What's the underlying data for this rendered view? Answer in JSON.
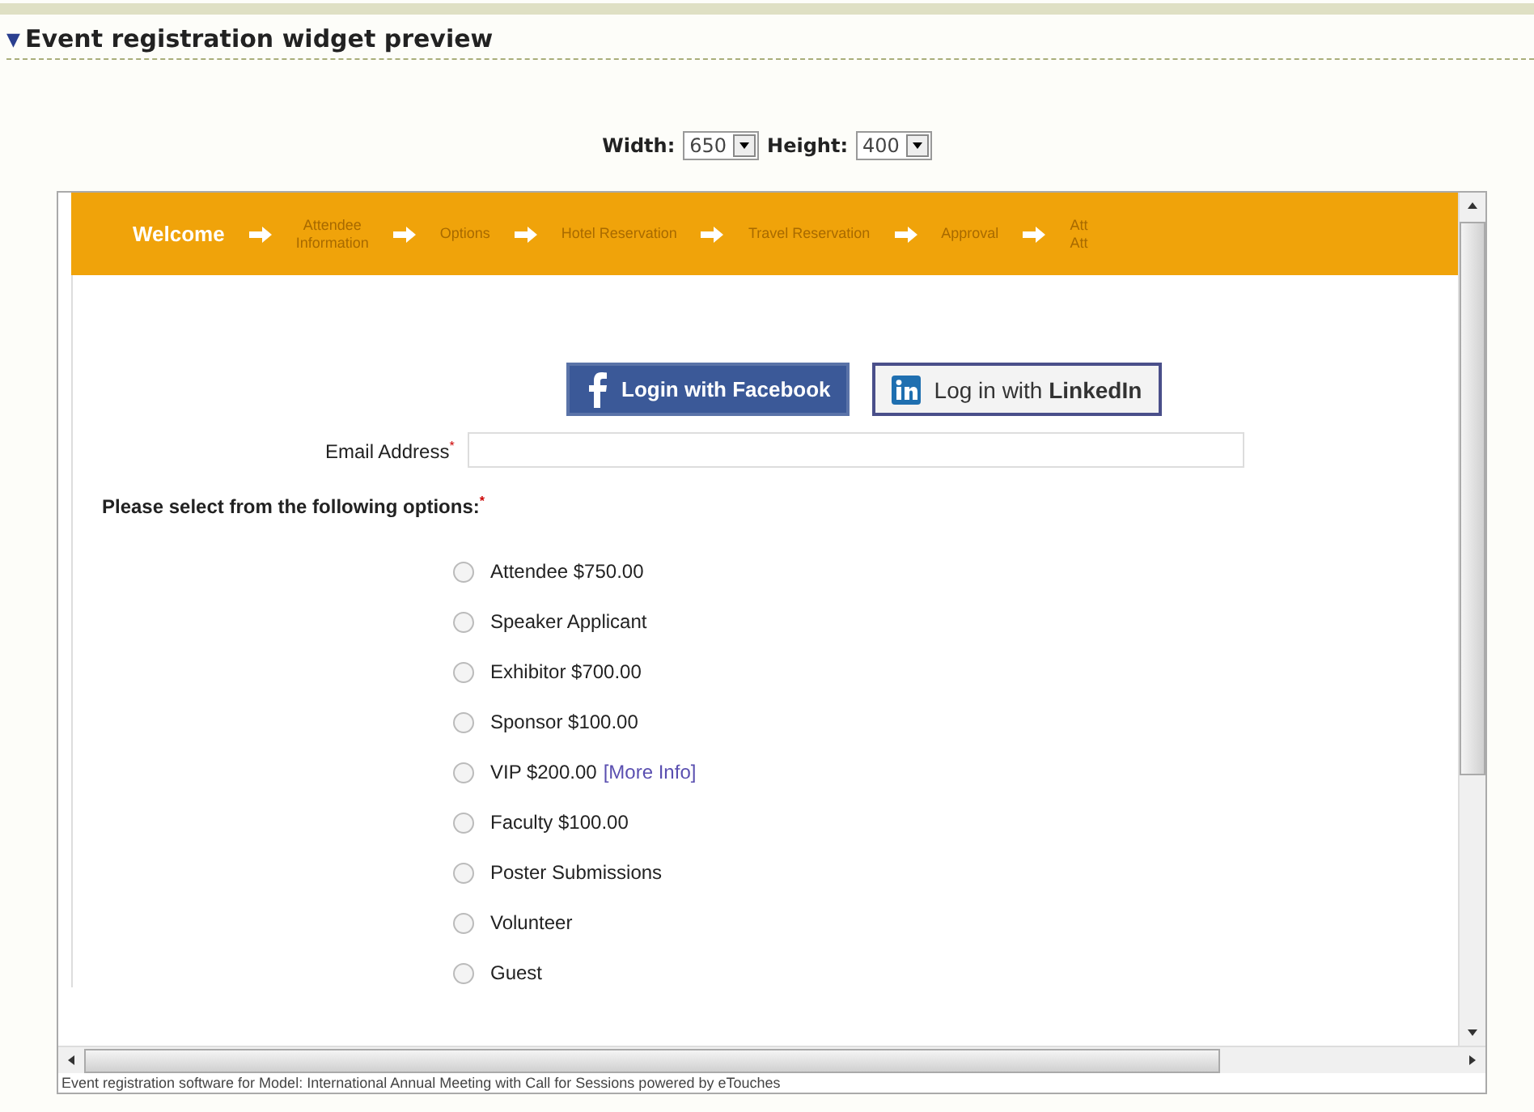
{
  "section": {
    "toggle": "▼",
    "title": "Event registration widget preview"
  },
  "size_controls": [
    {
      "label": "Width:",
      "value": "650"
    },
    {
      "label": "Height:",
      "value": "400"
    }
  ],
  "steps": [
    {
      "lines": [
        "Welcome"
      ],
      "selected": true
    },
    {
      "lines": [
        "Attendee",
        "Information"
      ],
      "selected": false
    },
    {
      "lines": [
        "Options"
      ],
      "selected": false
    },
    {
      "lines": [
        "Hotel Reservation"
      ],
      "selected": false
    },
    {
      "lines": [
        "Travel Reservation"
      ],
      "selected": false
    },
    {
      "lines": [
        "Approval"
      ],
      "selected": false
    },
    {
      "lines": [
        "Att",
        "Att"
      ],
      "selected": false
    }
  ],
  "social_buttons": [
    {
      "kind": "facebook",
      "label": "Login with Facebook"
    },
    {
      "kind": "linkedin",
      "label": "Log in with **LinkedIn**"
    }
  ],
  "email": {
    "label": "Email Address",
    "required_mark": "*"
  },
  "options_prompt": {
    "label": "Please select from the following options:",
    "required_mark": "*"
  },
  "options": [
    {
      "label": "Attendee $750.00",
      "selected": false
    },
    {
      "label": "Speaker Applicant",
      "selected": false
    },
    {
      "label": "Exhibitor $700.00",
      "selected": false
    },
    {
      "label": "Sponsor $100.00",
      "selected": false
    },
    {
      "label": "VIP $200.00",
      "link": "[More Info]",
      "selected": false
    },
    {
      "label": "Faculty $100.00",
      "selected": false
    },
    {
      "label": "Poster Submissions",
      "selected": false
    },
    {
      "label": "Volunteer",
      "selected": false
    },
    {
      "label": "Guest",
      "selected": false
    }
  ],
  "footer": "Event registration software for Model: International Annual Meeting with Call for Sessions powered by eTouches"
}
